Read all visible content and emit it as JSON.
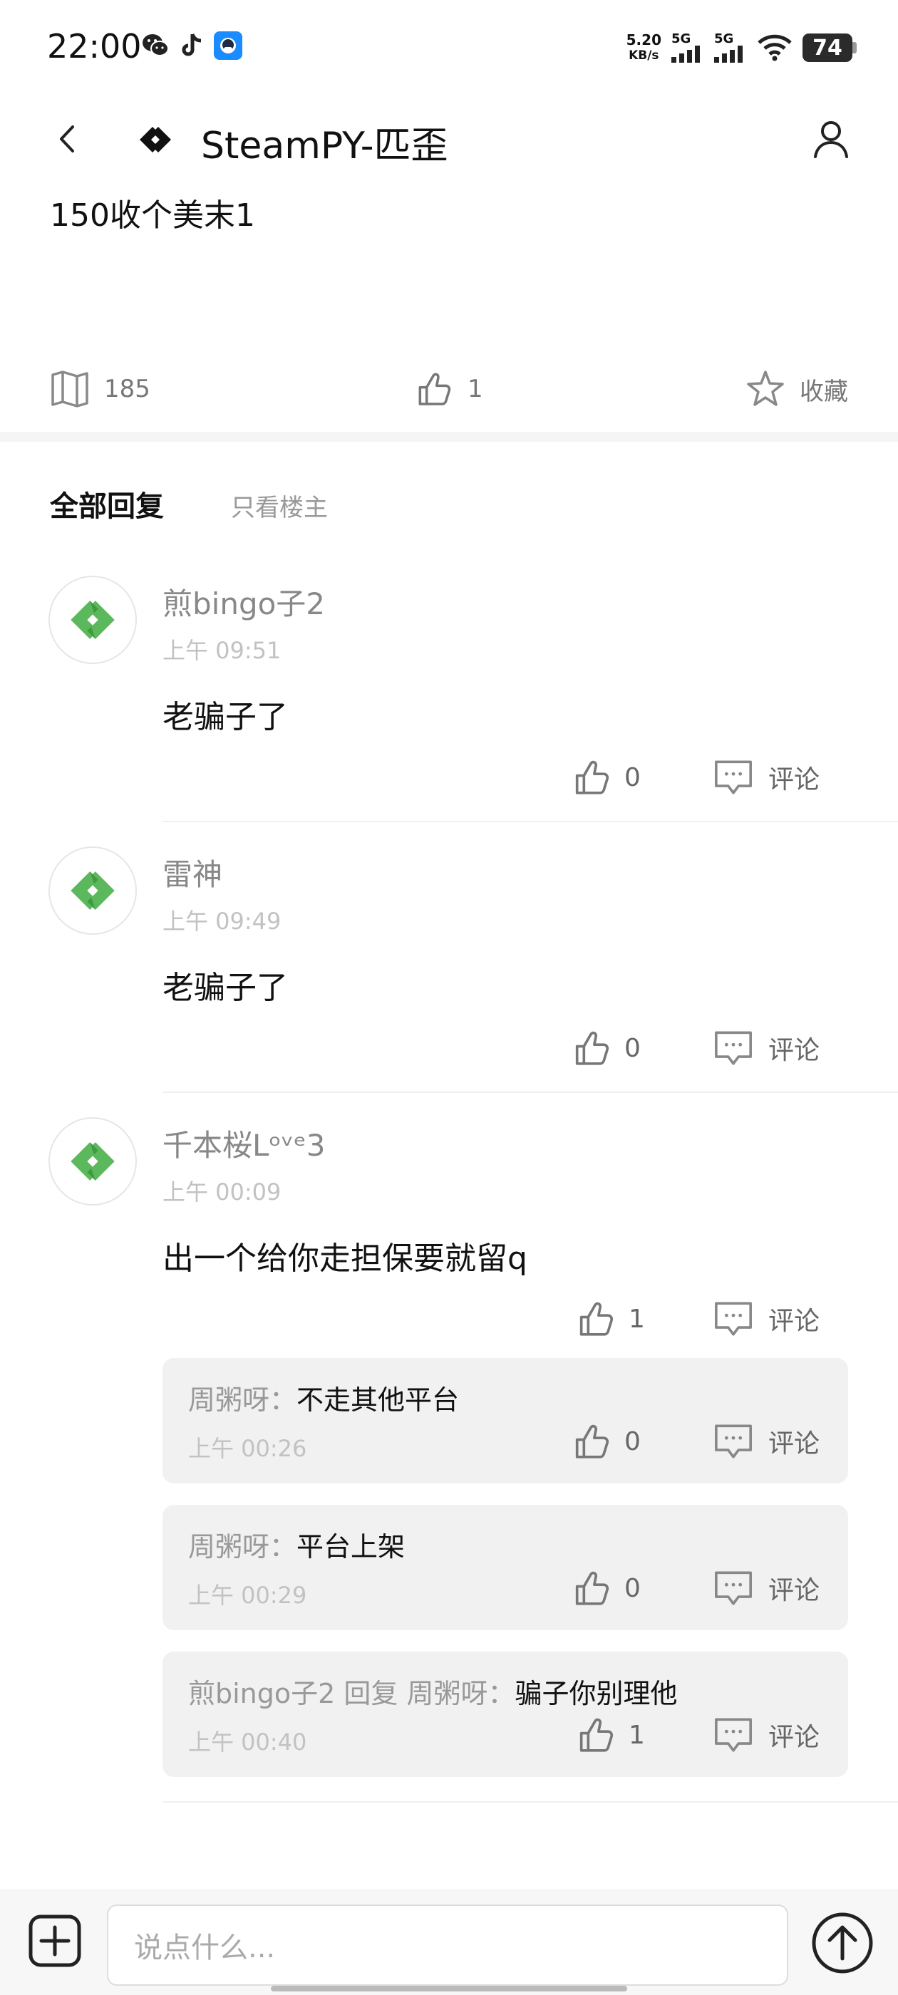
{
  "status_bar": {
    "time": "22:00",
    "net_speed_value": "5.20",
    "net_speed_unit": "KB/s",
    "signal1": "5G",
    "signal2": "5G",
    "battery": "74"
  },
  "header": {
    "title": "SteamPY-匹歪"
  },
  "post": {
    "body": "150收个美末1",
    "views": "185",
    "likes": "1",
    "favorite_label": "收藏"
  },
  "tabs": {
    "all": "全部回复",
    "owner_only": "只看楼主"
  },
  "comments": [
    {
      "user": "煎bingo子2",
      "time": "上午 09:51",
      "text": "老骗子了",
      "likes": "0",
      "reply_label": "评论"
    },
    {
      "user": "雷神",
      "time": "上午 09:49",
      "text": "老骗子了",
      "likes": "0",
      "reply_label": "评论"
    },
    {
      "user": "千本桜Lᵒᵛᵉ3",
      "time": "上午 00:09",
      "text": "出一个给你走担保要就留q",
      "likes": "1",
      "reply_label": "评论",
      "replies": [
        {
          "name": "周粥呀：",
          "text": "不走其他平台",
          "time": "上午 00:26",
          "likes": "0",
          "reply_label": "评论"
        },
        {
          "name": "周粥呀：",
          "text": "平台上架",
          "time": "上午 00:29",
          "likes": "0",
          "reply_label": "评论"
        },
        {
          "name": "煎bingo子2 回复 周粥呀：",
          "text": "骗子你别理他",
          "time": "上午 00:40",
          "likes": "1",
          "reply_label": "评论"
        }
      ]
    }
  ],
  "input": {
    "placeholder": "说点什么..."
  }
}
